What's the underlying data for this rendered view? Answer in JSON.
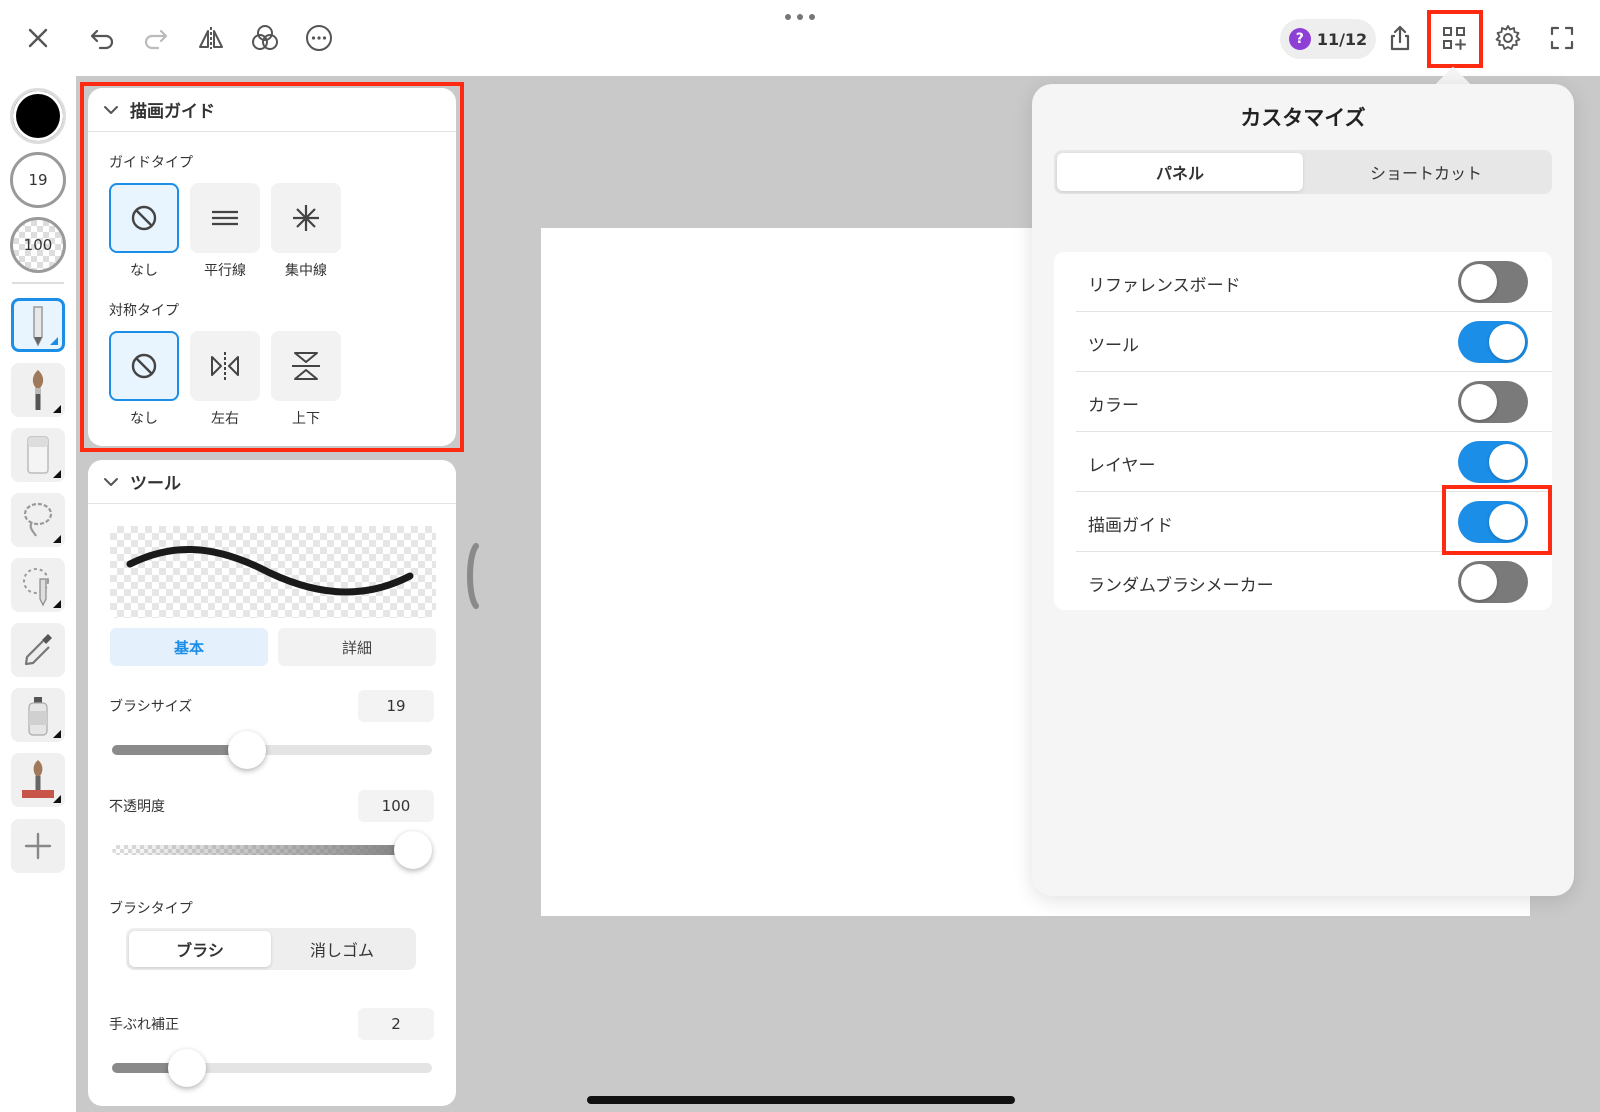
{
  "toolbar": {
    "counter": "11/12",
    "counter_icon": "?",
    "icons": [
      "close-icon",
      "undo-icon",
      "redo-icon",
      "flip-horizontal-icon",
      "color-blend-icon",
      "more-icon",
      "share-icon",
      "customize-panel-icon",
      "settings-icon",
      "fullscreen-icon"
    ]
  },
  "left_strip": {
    "brush_size": "19",
    "opacity": "100",
    "color": "#000000"
  },
  "guide_panel": {
    "title": "描画ガイド",
    "guide_type_label": "ガイドタイプ",
    "guide_types": [
      "なし",
      "平行線",
      "集中線"
    ],
    "guide_selected": "なし",
    "symmetry_type_label": "対称タイプ",
    "symmetry_types": [
      "なし",
      "左右",
      "上下"
    ],
    "symmetry_selected": "なし"
  },
  "tool_panel": {
    "title": "ツール",
    "tabs": [
      "基本",
      "詳細"
    ],
    "active_tab": "基本",
    "brush_size_label": "ブラシサイズ",
    "brush_size_value": "19",
    "brush_size_fraction": 0.41,
    "opacity_label": "不透明度",
    "opacity_value": "100",
    "opacity_fraction": 1.0,
    "brush_type_label": "ブラシタイプ",
    "brush_types": [
      "ブラシ",
      "消しゴム"
    ],
    "brush_type_selected": "ブラシ",
    "stabilizer_label": "手ぶれ補正",
    "stabilizer_value": "2",
    "stabilizer_fraction": 0.2
  },
  "customize": {
    "title": "カスタマイズ",
    "tabs": [
      "パネル",
      "ショートカット"
    ],
    "active_tab": "パネル",
    "items": [
      {
        "label": "リファレンスボード",
        "on": false
      },
      {
        "label": "ツール",
        "on": true
      },
      {
        "label": "カラー",
        "on": false
      },
      {
        "label": "レイヤー",
        "on": true
      },
      {
        "label": "描画ガイド",
        "on": true
      },
      {
        "label": "ランダムブラシメーカー",
        "on": false
      }
    ]
  },
  "colors": {
    "accent": "#1b8ee8",
    "highlight": "#ff2a12",
    "toggle_off": "#7a7a7a"
  }
}
